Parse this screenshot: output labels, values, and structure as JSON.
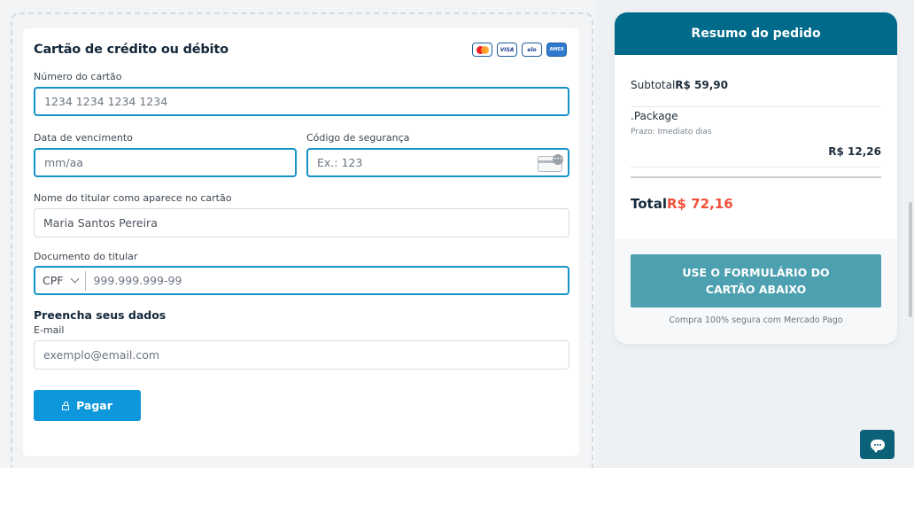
{
  "card_form": {
    "title": "Cartão de crédito ou débito",
    "brands": [
      "MASTERCARD",
      "VISA",
      "elo",
      "AMEX"
    ],
    "card_number": {
      "label": "Número do cartão",
      "placeholder": "1234 1234 1234 1234"
    },
    "expiry": {
      "label": "Data de vencimento",
      "placeholder": "mm/aa"
    },
    "cvv": {
      "label": "Código de segurança",
      "placeholder": "Ex.: 123"
    },
    "holder_name": {
      "label": "Nome do titular como aparece no cartão",
      "value": "Maria Santos Pereira"
    },
    "document": {
      "label": "Documento do titular",
      "type": "CPF",
      "placeholder": "999.999.999-99"
    }
  },
  "personal": {
    "title": "Preencha seus dados",
    "email": {
      "label": "E-mail",
      "placeholder": "exemplo@email.com"
    }
  },
  "pay_button": {
    "label": "Pagar"
  },
  "summary": {
    "title": "Resumo do pedido",
    "subtotal_label": "Subtotal",
    "subtotal_value": "R$ 59,90",
    "package_name": ".Package",
    "package_term": "Prazo: Imediato dias",
    "package_price": "R$ 12,26",
    "total_label": "Total",
    "total_value": "R$ 72,16",
    "form_button": "USE O FORMULÁRIO DO CARTÃO ABAIXO",
    "secure_text": "Compra 100% segura com Mercado Pago"
  },
  "colors": {
    "header": "#006a8a",
    "pay_button": "#0e97db",
    "total": "#f0503a",
    "form_button": "#4da0b0"
  }
}
